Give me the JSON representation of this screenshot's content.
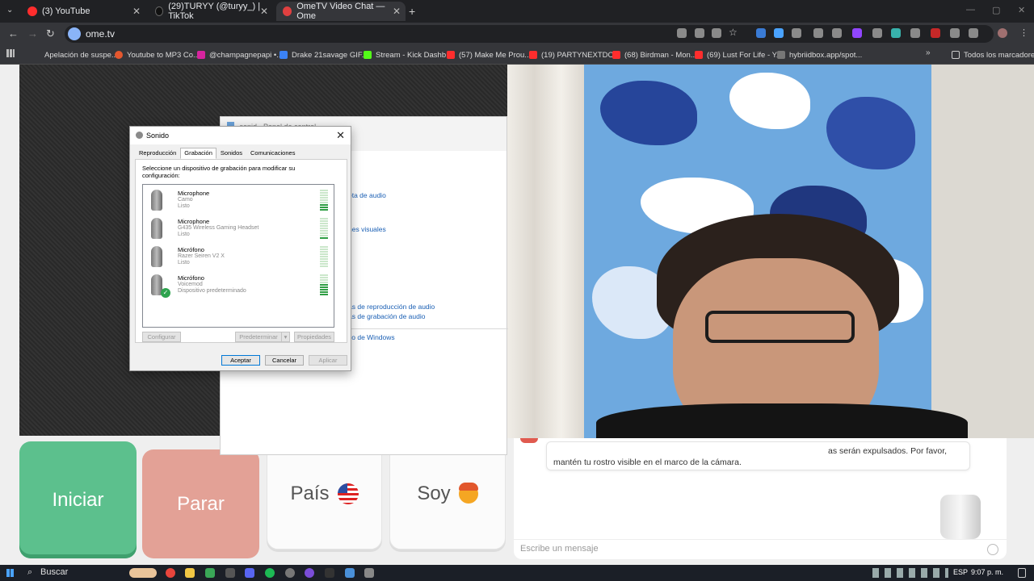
{
  "tabs": [
    {
      "label": "(3) YouTube",
      "color": "#ff2d2d"
    },
    {
      "label": "(29)TURYY (@turyy_) | TikTok",
      "color": "#111111"
    },
    {
      "label": "OmeTV Video Chat — Ome",
      "color": "#e04040"
    }
  ],
  "url": "ome.tv",
  "bookmarks": [
    "Apelación de suspe...",
    "Youtube to MP3 Co...",
    "@champagnepapi •...",
    "Drake 21savage GIF...",
    "Stream - Kick Dashb...",
    "(57) Make Me Prou...",
    "(19) PARTYNEXTDO...",
    "(68) Birdman - Mon...",
    "(69) Lust For Life - Y...",
    "hybriidbox.app/spot...",
    "Todos los marcadores"
  ],
  "control_panel": {
    "title": "sonid - Panel de control",
    "links": [
      "eta de audio",
      "nes visuales",
      "as de reproducción de audio",
      "as de grabación de audio",
      "co de Windows"
    ]
  },
  "dialog": {
    "title": "Sonido",
    "tabs": [
      "Reproducción",
      "Grabación",
      "Sonidos",
      "Comunicaciones"
    ],
    "instruction": "Seleccione un dispositivo de grabación para modificar su configuración:",
    "devices": [
      {
        "name": "Microphone",
        "model": "Camo",
        "status": "Listo",
        "level": 0.3
      },
      {
        "name": "Microphone",
        "model": "G435 Wireless Gaming Headset",
        "status": "Listo",
        "level": 0.1
      },
      {
        "name": "Micrófono",
        "model": "Razer Seiren V2 X",
        "status": "Listo",
        "level": 0.05
      },
      {
        "name": "Micrófono",
        "model": "Voicemod",
        "status": "Dispositivo predeterminado",
        "level": 0.55,
        "default": true
      }
    ],
    "configure": "Configurar",
    "set_default": "Predeterminar",
    "properties": "Propiedades",
    "ok": "Aceptar",
    "cancel": "Cancelar",
    "apply": "Aplicar"
  },
  "controls": {
    "start": "Iniciar",
    "stop": "Parar",
    "country": "País",
    "gender": "Soy"
  },
  "chat": {
    "message_line1": "as serán expulsados. Por favor,",
    "message_line2": "mantén tu rostro visible en el marco de la cámara.",
    "placeholder": "Escribe un mensaje"
  },
  "taskbar": {
    "search": "Buscar",
    "language": "ESP",
    "time": "9:07 p. m."
  },
  "colors": {
    "start": "#5cc08d",
    "stop": "#e3a196",
    "link": "#1a5fb4"
  }
}
